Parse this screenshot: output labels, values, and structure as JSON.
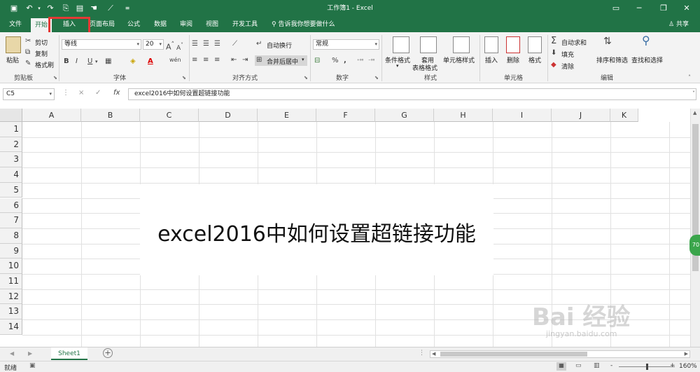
{
  "title_bar": {
    "title": "工作簿1 - Excel",
    "quick_access": [
      "save-icon",
      "undo-icon",
      "redo-icon",
      "print-preview-icon",
      "print-icon",
      "touch-mode-icon",
      "draw-icon",
      "customize-icon"
    ]
  },
  "tabs": {
    "file": "文件",
    "home": "开始",
    "insert": "插入",
    "page_layout": "页面布局",
    "formulas": "公式",
    "data": "数据",
    "review": "审阅",
    "view": "视图",
    "developer": "开发工具",
    "tell_me": "告诉我你想要做什么",
    "share": "共享"
  },
  "ribbon": {
    "clipboard": {
      "paste": "粘贴",
      "cut": "剪切",
      "copy": "复制",
      "format_painter": "格式刷",
      "label": "剪贴板"
    },
    "font": {
      "font_name": "等线",
      "font_size": "20",
      "label": "字体",
      "bold": "B",
      "italic": "I",
      "underline": "U",
      "grow": "A",
      "shrink": "A",
      "wen": "wén"
    },
    "alignment": {
      "wrap_text": "自动换行",
      "merge_center": "合并后居中",
      "label": "对齐方式"
    },
    "number": {
      "format": "常规",
      "percent": "%",
      "comma": ",",
      "label": "数字"
    },
    "styles": {
      "conditional": "条件格式",
      "table": "套用\n表格格式",
      "table1": "套用",
      "table2": "表格格式",
      "cell_styles": "单元格样式",
      "label": "样式"
    },
    "cells": {
      "insert": "插入",
      "delete": "删除",
      "format": "格式",
      "label": "单元格"
    },
    "editing": {
      "autosum": "自动求和",
      "fill": "填充",
      "clear": "清除",
      "sort_filter": "排序和筛选",
      "find_select": "查找和选择",
      "label": "编辑"
    }
  },
  "formula_bar": {
    "name_box": "C5",
    "cancel": "×",
    "enter": "✓",
    "fx": "fx",
    "content": "excel2016中如何设置超链接功能"
  },
  "grid": {
    "columns": [
      "A",
      "B",
      "C",
      "D",
      "E",
      "F",
      "G",
      "H",
      "I",
      "J",
      "K"
    ],
    "rows": [
      "1",
      "2",
      "3",
      "4",
      "5",
      "6",
      "7",
      "8",
      "9",
      "10",
      "11",
      "12",
      "13",
      "14"
    ],
    "merged_cell_text": "excel2016中如何设置超链接功能"
  },
  "sheets": {
    "active": "Sheet1",
    "add": "+"
  },
  "status_bar": {
    "ready": "就绪",
    "zoom": "160%",
    "zoom_minus": "-",
    "zoom_plus": "+"
  },
  "badge": "70",
  "watermark": "Bai 经验",
  "watermark_url": "jingyan.baidu.com",
  "colors": {
    "excel_green": "#217346",
    "highlight_red": "#e53935"
  }
}
